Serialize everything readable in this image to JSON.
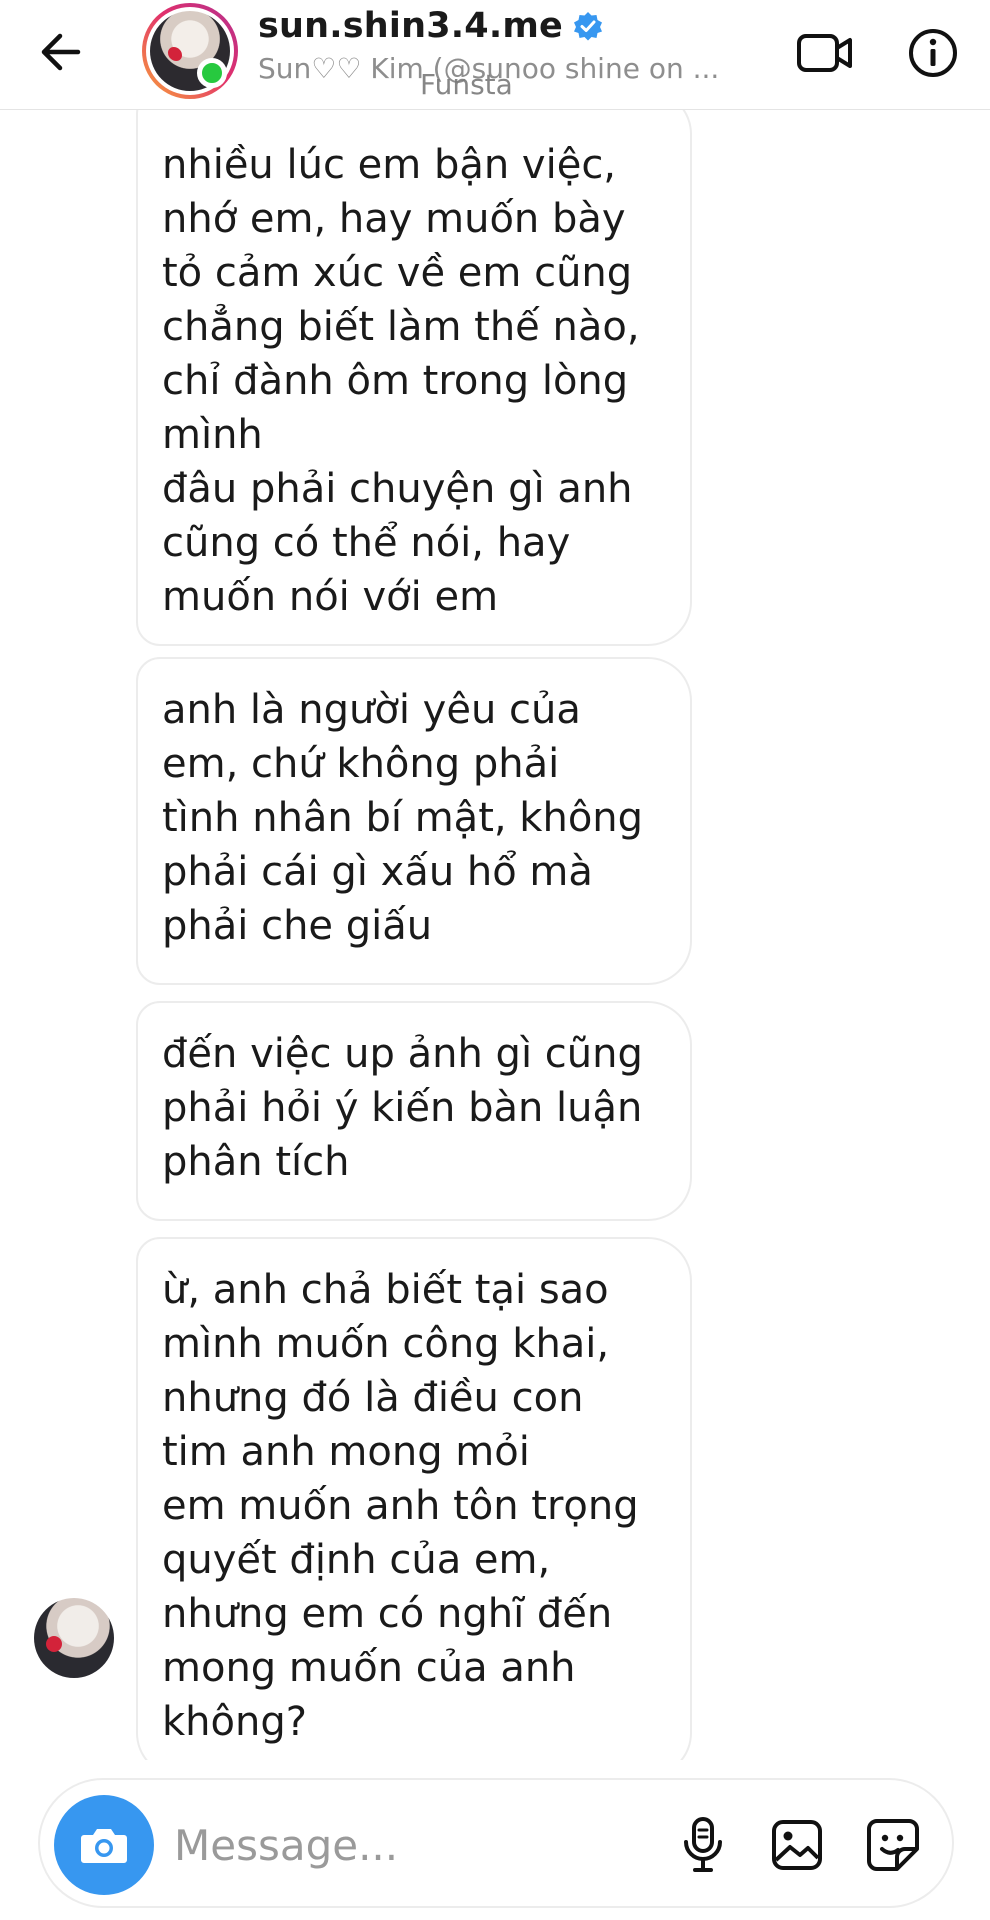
{
  "header": {
    "username": "sun.shin3.4.me",
    "subtitle": "Sun♡♡ Kim (@sunoo shine on ...",
    "subtitle_overlay": "Funsta",
    "verified": true,
    "online": true
  },
  "messages": [
    {
      "text": "nhiều lúc em bận việc,\nnhớ em, hay muốn bày\ntỏ cảm xúc về em cũng\nchẳng biết làm thế nào,\nchỉ đành ôm trong lòng\nmình\nđâu phải chuyện gì anh\ncũng có thể nói, hay\nmuốn nói với em"
    },
    {
      "text": "anh là người yêu của\nem, chứ không phải\ntình nhân bí mật, không\nphải cái gì xấu hổ mà\nphải che giấu"
    },
    {
      "text": "đến việc up ảnh gì cũng\nphải hỏi ý kiến bàn luận\nphân tích"
    },
    {
      "text": "ừ, anh chả biết tại sao\nmình muốn công khai,\nnhưng đó là điều con\ntim anh mong mỏi\nem muốn anh tôn trọng\nquyết định của em,\nnhưng em có nghĩ đến\nmong muốn của anh\nkhông?"
    }
  ],
  "composer": {
    "placeholder": "Message...",
    "value": ""
  },
  "icons": {
    "back": "arrow-left-icon",
    "video": "video-camera-icon",
    "info": "info-icon",
    "camera": "camera-icon",
    "mic": "microphone-icon",
    "gallery": "image-icon",
    "sticker": "sticker-icon"
  },
  "colors": {
    "accent": "#3797f0",
    "online": "#27c93f",
    "bubble_border": "#ececec",
    "muted_text": "#8e8e8e"
  }
}
